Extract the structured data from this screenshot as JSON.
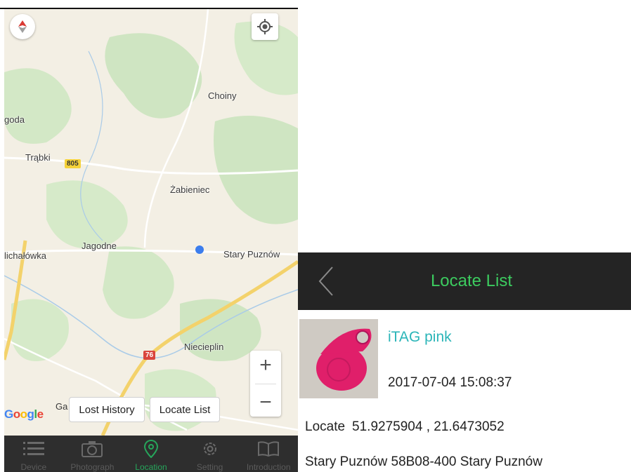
{
  "map": {
    "labels": {
      "choiny": "Choiny",
      "goda": "goda",
      "trabki": "Trąbki",
      "zabieniec": "Żabieniec",
      "jagodne": "Jagodne",
      "stary_puznow": "Stary Puznów",
      "lichalowka": "lichałówka",
      "niecieplin": "Niecieplin",
      "ga": "Ga"
    },
    "road_badges": {
      "r805": "805",
      "r76": "76"
    },
    "attribution": "Google",
    "zoom_in": "+",
    "zoom_out": "−",
    "lost_history": "Lost History",
    "locate_list": "Locate List"
  },
  "tabs": [
    {
      "label": "Device",
      "icon": "list-icon"
    },
    {
      "label": "Photograph",
      "icon": "camera-icon"
    },
    {
      "label": "Location",
      "icon": "location-pin-icon"
    },
    {
      "label": "Setting",
      "icon": "gear-icon"
    },
    {
      "label": "Introduction",
      "icon": "book-icon"
    }
  ],
  "locate_list": {
    "title": "Locate List",
    "device_name": "iTAG pink",
    "timestamp": "2017-07-04 15:08:37",
    "locate_label": "Locate",
    "coordinates": "51.9275904 , 21.6473052",
    "address": "Stary Puznów 58B08-400 Stary Puznów"
  },
  "colors": {
    "accent_green": "#3ccb5f",
    "title_teal": "#2bb5b8",
    "header_bg": "#242424",
    "tab_bg": "#2e2e2e",
    "marker_blue": "#3b7ded"
  }
}
